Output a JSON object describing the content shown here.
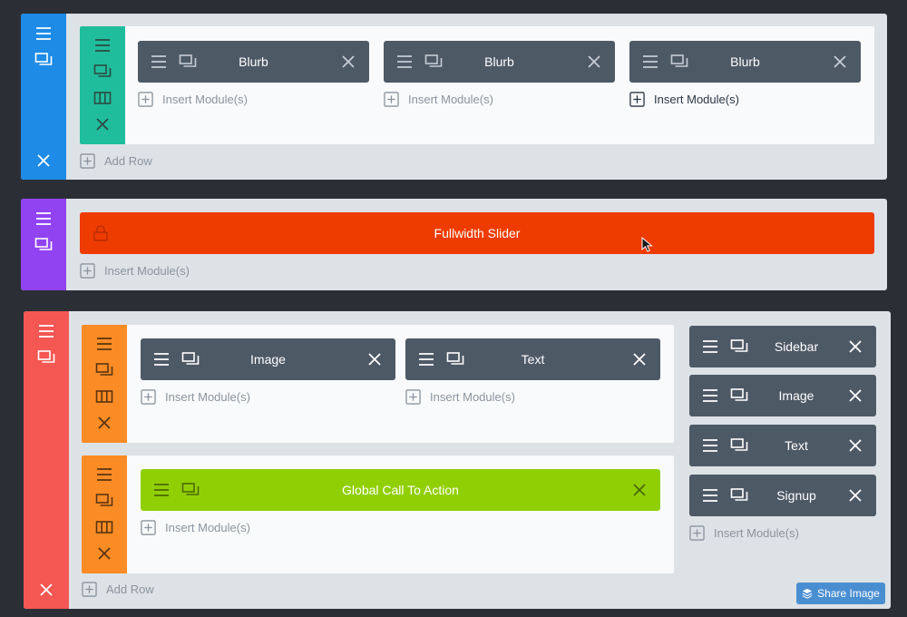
{
  "colors": {
    "background": "#2b2f35",
    "section_bg": "#dde2e6",
    "row_bg": "#f9fafb",
    "module_dark": "#4e5966",
    "section1_bar": "#1e8be6",
    "row1_bar": "#1fbd9c",
    "section2_bar": "#9143f2",
    "slider_orange": "#ee3b00",
    "section3_bar": "#f55753",
    "row_orange": "#fb8c25",
    "global_green": "#91cf05",
    "share_blue": "#4a8ed2"
  },
  "sections": [
    {
      "rows": [
        {
          "columns": [
            {
              "modules": [
                {
                  "label": "Blurb"
                }
              ],
              "insert_label": "Insert Module(s)"
            },
            {
              "modules": [
                {
                  "label": "Blurb"
                }
              ],
              "insert_label": "Insert Module(s)"
            },
            {
              "modules": [
                {
                  "label": "Blurb"
                }
              ],
              "insert_label": "Insert Module(s)"
            }
          ]
        }
      ],
      "add_row_label": "Add Row"
    },
    {
      "fullwidth_module": {
        "label": "Fullwidth Slider",
        "locked": true
      },
      "insert_label": "Insert Module(s)"
    },
    {
      "rows": [
        {
          "columns": [
            {
              "modules": [
                {
                  "label": "Image"
                }
              ],
              "insert_label": "Insert Module(s)"
            },
            {
              "modules": [
                {
                  "label": "Text"
                }
              ],
              "insert_label": "Insert Module(s)"
            }
          ]
        },
        {
          "columns": [
            {
              "modules": [
                {
                  "label": "Global Call To Action",
                  "global": true
                }
              ],
              "insert_label": "Insert Module(s)"
            }
          ]
        }
      ],
      "sidebar_column": {
        "modules": [
          {
            "label": "Sidebar"
          },
          {
            "label": "Image"
          },
          {
            "label": "Text"
          },
          {
            "label": "Signup"
          }
        ],
        "insert_label": "Insert Module(s)"
      },
      "add_row_label": "Add Row"
    }
  ],
  "share_button": {
    "label": "Share Image",
    "icon": "layers-icon"
  }
}
